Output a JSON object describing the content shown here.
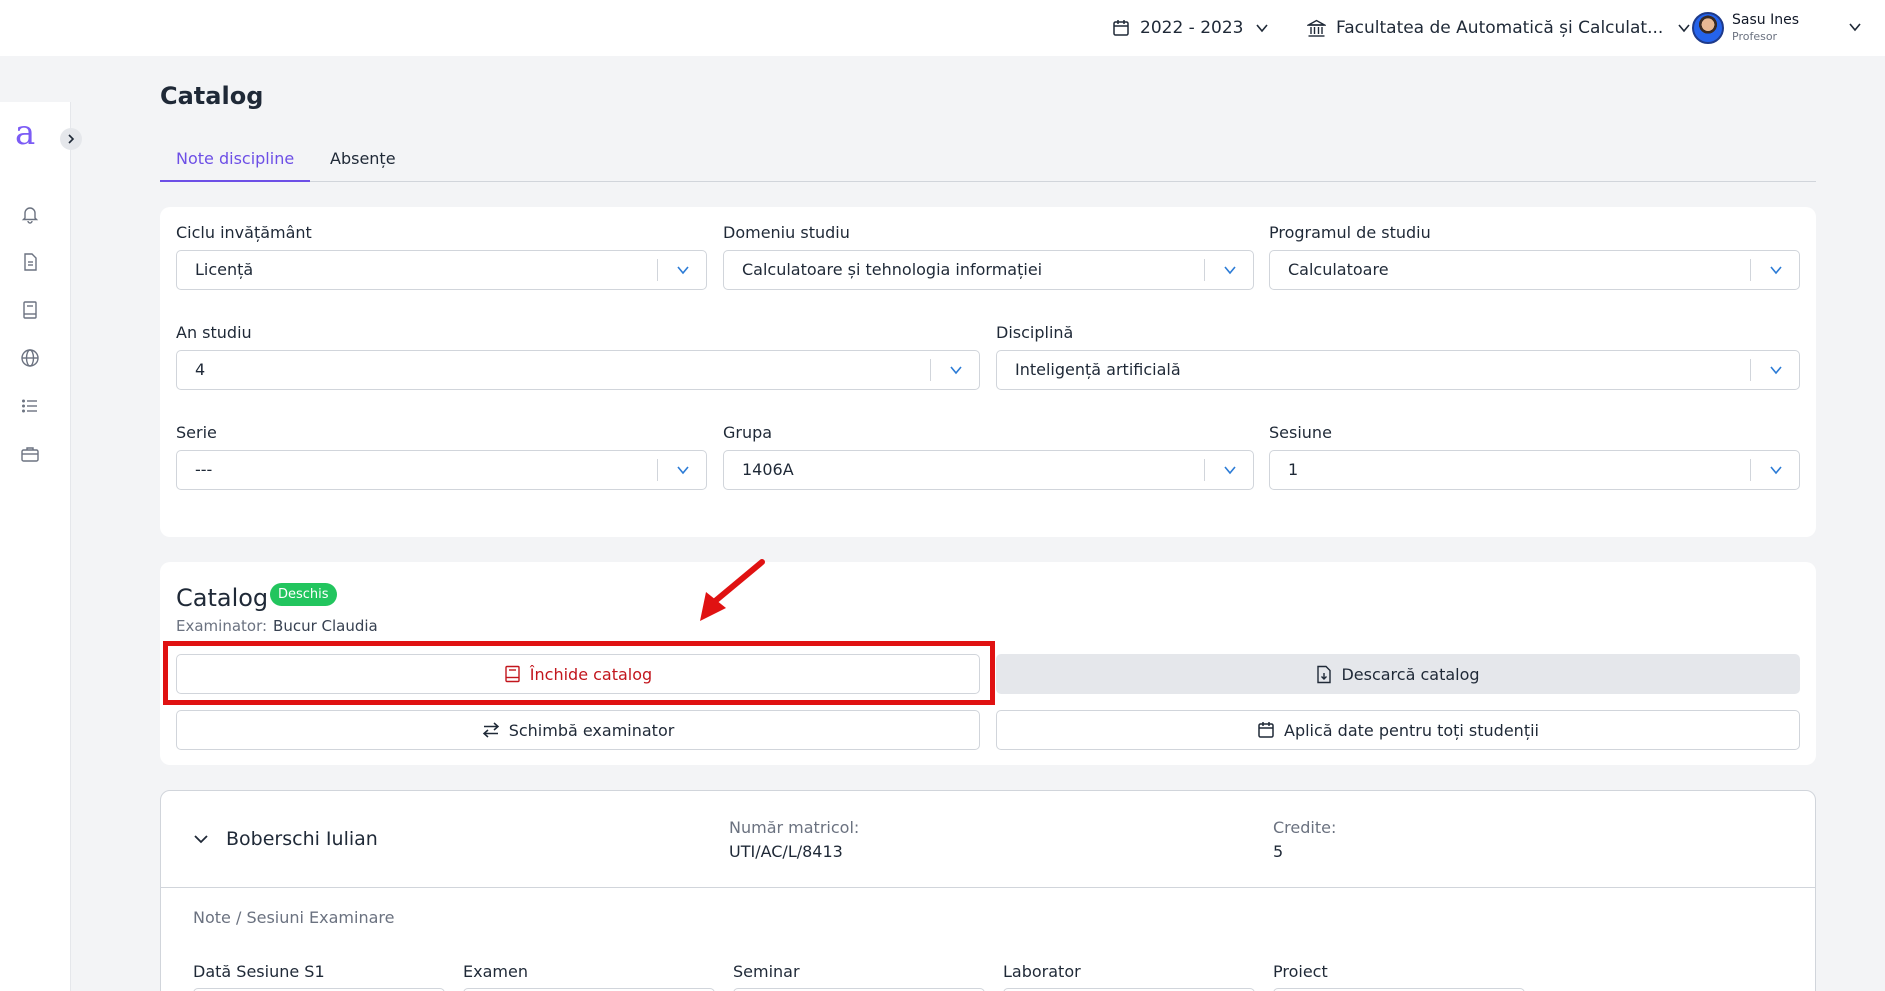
{
  "topbar": {
    "year": "2022 - 2023",
    "faculty": "Facultatea de Automatică și Calculat...",
    "user_name": "Sasu Ines",
    "user_role": "Profesor"
  },
  "sidebar": {
    "logo": "a",
    "icons": [
      "bell-icon",
      "document-icon",
      "book-icon",
      "globe-icon",
      "list-icon",
      "briefcase-icon"
    ]
  },
  "page": {
    "title": "Catalog",
    "tabs": [
      {
        "label": "Note discipline",
        "active": true
      },
      {
        "label": "Absențe",
        "active": false
      }
    ]
  },
  "filters": {
    "ciclu": {
      "label": "Ciclu invățământ",
      "value": "Licență"
    },
    "domeniu": {
      "label": "Domeniu studiu",
      "value": "Calculatoare și tehnologia informației"
    },
    "program": {
      "label": "Programul de studiu",
      "value": "Calculatoare"
    },
    "an": {
      "label": "An studiu",
      "value": "4"
    },
    "disciplina": {
      "label": "Disciplină",
      "value": "Inteligență artificială"
    },
    "serie": {
      "label": "Serie",
      "value": "---"
    },
    "grupa": {
      "label": "Grupa",
      "value": "1406A"
    },
    "sesiune": {
      "label": "Sesiune",
      "value": "1"
    }
  },
  "catalog": {
    "title": "Catalog",
    "status": "Deschis",
    "status_color": "#22c55e",
    "examinator_label": "Examinator:",
    "examinator_name": "Bucur Claudia",
    "close_label": "Închide catalog",
    "download_label": "Descarcă catalog",
    "change_examiner_label": "Schimbă examinator",
    "apply_dates_label": "Aplică date pentru toți studenții"
  },
  "student": {
    "name": "Boberschi Iulian",
    "matricol_label": "Număr matricol:",
    "matricol_value": "UTI/AC/L/8413",
    "credits_label": "Credite:",
    "credits_value": "5",
    "section_label": "Note / Sesiuni Examinare",
    "columns": [
      "Dată Sesiune S1",
      "Examen",
      "Seminar",
      "Laborator",
      "Proiect"
    ]
  },
  "colors": {
    "accent": "#6d4fe6",
    "highlight": "#e01212",
    "danger_text": "#c2161d"
  }
}
